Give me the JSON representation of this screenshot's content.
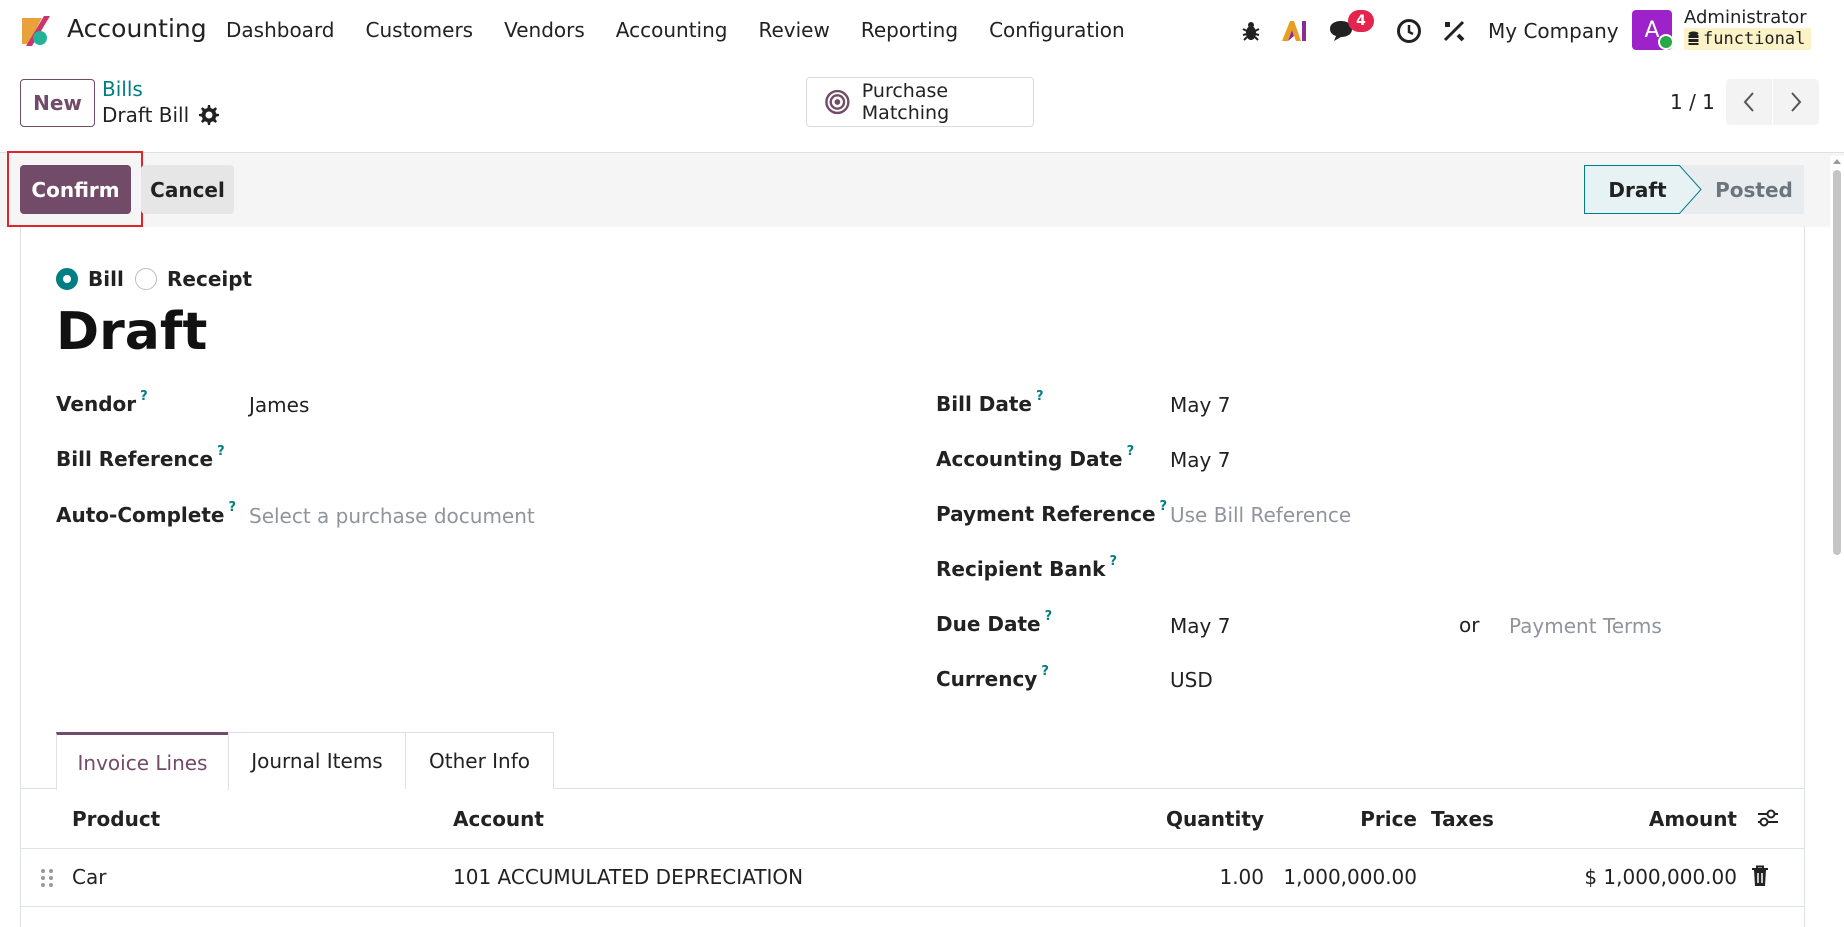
{
  "app": {
    "name": "Accounting"
  },
  "menu": [
    "Dashboard",
    "Customers",
    "Vendors",
    "Accounting",
    "Review",
    "Reporting",
    "Configuration"
  ],
  "systray": {
    "icons": [
      "bug-icon",
      "ai-icon",
      "chat-icon",
      "clock-icon",
      "tools-icon"
    ],
    "messages_badge": "4",
    "company": "My Company",
    "user_initial": "A",
    "user_name": "Administrator",
    "database": "functional"
  },
  "control_panel": {
    "new_label": "New",
    "breadcrumb_parent": "Bills",
    "breadcrumb_current": "Draft Bill",
    "purchase_matching_label": "Purchase Matching",
    "pager": "1 / 1"
  },
  "statusbar": {
    "confirm_label": "Confirm",
    "cancel_label": "Cancel",
    "stages": [
      "Draft",
      "Posted"
    ],
    "active_stage": "Draft"
  },
  "form": {
    "move_type_options": [
      "Bill",
      "Receipt"
    ],
    "selected_move_type": "Bill",
    "title": "Draft",
    "left": {
      "vendor": {
        "label": "Vendor",
        "value": "James"
      },
      "bill_reference": {
        "label": "Bill Reference",
        "value": ""
      },
      "auto_complete": {
        "label": "Auto-Complete",
        "placeholder": "Select a purchase document"
      }
    },
    "right": {
      "bill_date": {
        "label": "Bill Date",
        "value": "May 7"
      },
      "accounting_date": {
        "label": "Accounting Date",
        "value": "May 7"
      },
      "payment_reference": {
        "label": "Payment Reference",
        "placeholder": "Use Bill Reference"
      },
      "recipient_bank": {
        "label": "Recipient Bank",
        "value": ""
      },
      "due_date": {
        "label": "Due Date",
        "value": "May 7",
        "or": "or",
        "terms_placeholder": "Payment Terms"
      },
      "currency": {
        "label": "Currency",
        "value": "USD"
      }
    },
    "help_mark": "?"
  },
  "tabs": [
    "Invoice Lines",
    "Journal Items",
    "Other Info"
  ],
  "active_tab": "Invoice Lines",
  "lines": {
    "columns": [
      "Product",
      "Account",
      "Quantity",
      "Price",
      "Taxes",
      "Amount"
    ],
    "rows": [
      {
        "product": "Car",
        "account": "101 ACCUMULATED DEPRECIATION",
        "quantity": "1.00",
        "price": "1,000,000.00",
        "taxes": "",
        "amount": "$ 1,000,000.00"
      }
    ]
  },
  "colors": {
    "primary": "#714b67",
    "accent": "#017e84",
    "badge": "#e3244c",
    "highlight": "#e0242c"
  }
}
